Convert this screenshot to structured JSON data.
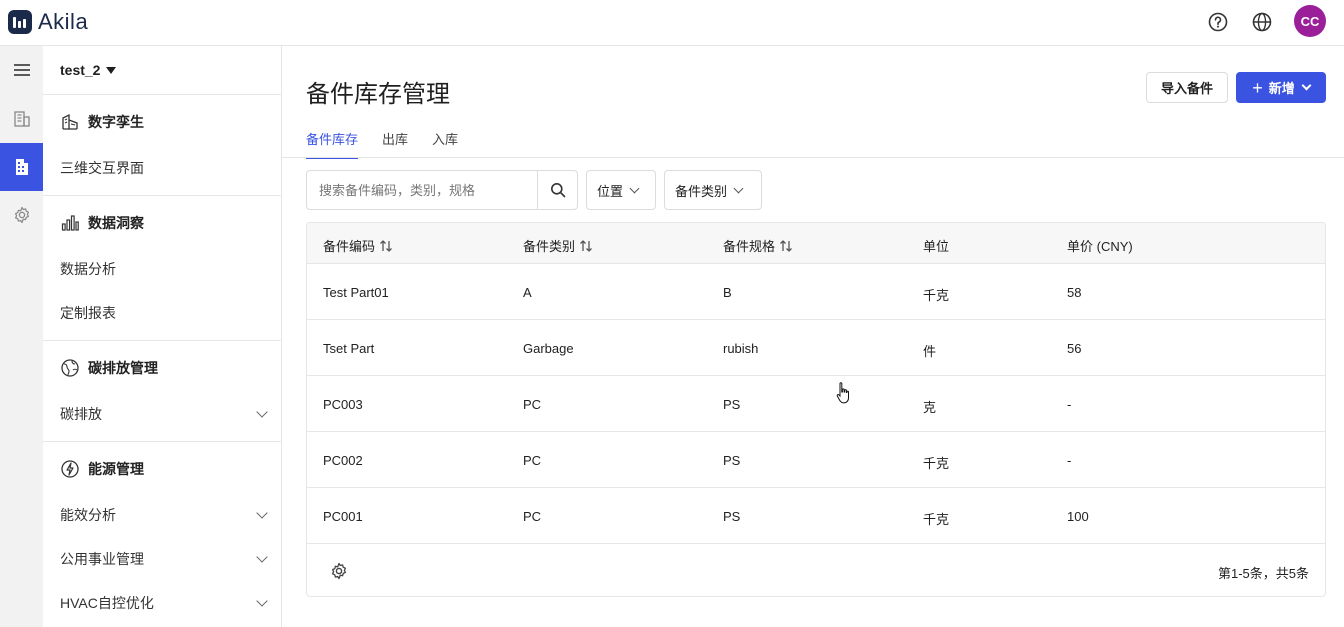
{
  "app": {
    "name": "Akila",
    "avatar": "CC"
  },
  "sidebar": {
    "project": "test_2",
    "sections": [
      {
        "title": "数字孪生",
        "items": [
          {
            "label": "三维交互界面"
          }
        ]
      },
      {
        "title": "数据洞察",
        "items": [
          {
            "label": "数据分析"
          },
          {
            "label": "定制报表"
          }
        ]
      },
      {
        "title": "碳排放管理",
        "items": [
          {
            "label": "碳排放"
          }
        ]
      },
      {
        "title": "能源管理",
        "items": [
          {
            "label": "能效分析"
          },
          {
            "label": "公用事业管理"
          },
          {
            "label": "HVAC自控优化"
          }
        ]
      }
    ]
  },
  "page": {
    "title": "备件库存管理",
    "import_label": "导入备件",
    "new_label": "新增",
    "tabs": [
      {
        "label": "备件库存"
      },
      {
        "label": "出库"
      },
      {
        "label": "入库"
      }
    ],
    "search_placeholder": "搜索备件编码，类别，规格",
    "filters": [
      {
        "label": "位置"
      },
      {
        "label": "备件类别"
      }
    ]
  },
  "table": {
    "columns": [
      {
        "label": "备件编码"
      },
      {
        "label": "备件类别"
      },
      {
        "label": "备件规格"
      },
      {
        "label": "单位"
      },
      {
        "label": "单价 (CNY)"
      }
    ],
    "rows": [
      {
        "code": "Test Part01",
        "category": "A",
        "spec": "B",
        "unit": "千克",
        "price": "58"
      },
      {
        "code": "Tset Part",
        "category": "Garbage",
        "spec": "rubish",
        "unit": "件",
        "price": "56"
      },
      {
        "code": "PC003",
        "category": "PC",
        "spec": "PS",
        "unit": "克",
        "price": "-"
      },
      {
        "code": "PC002",
        "category": "PC",
        "spec": "PS",
        "unit": "千克",
        "price": "-"
      },
      {
        "code": "PC001",
        "category": "PC",
        "spec": "PS",
        "unit": "千克",
        "price": "100"
      }
    ],
    "footer": "第1-5条，共5条"
  },
  "colors": {
    "accent": "#3a53e0",
    "avatar": "#9c1f9a",
    "brand": "#1b2a4a"
  }
}
